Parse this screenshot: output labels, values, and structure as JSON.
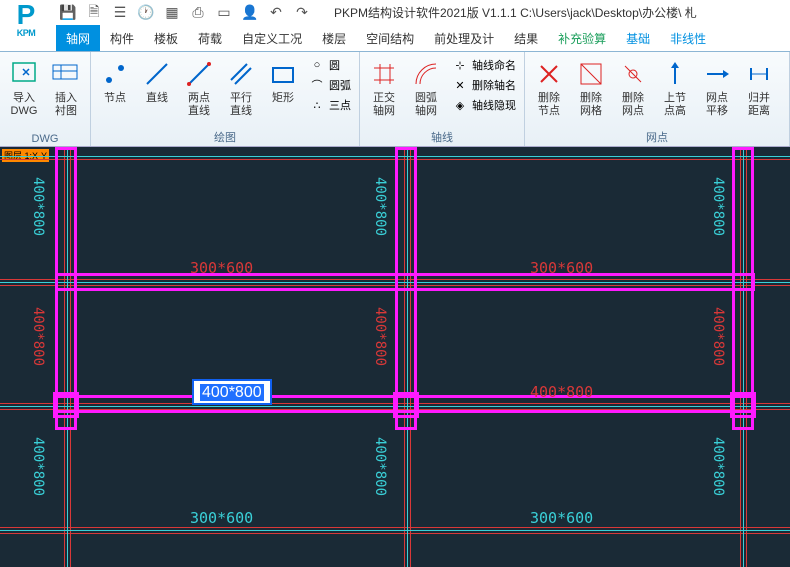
{
  "title": "PKPM结构设计软件2021版 V1.1.1 C:\\Users\\jack\\Desktop\\办公楼\\ 札",
  "menu": {
    "items": [
      "轴网",
      "构件",
      "楼板",
      "荷载",
      "自定义工况",
      "楼层",
      "空间结构",
      "前处理及计",
      "结果",
      "补充验算",
      "基础",
      "非线性"
    ],
    "active_index": 0,
    "green_indices": [
      9
    ],
    "blue_indices": [
      10,
      11
    ]
  },
  "ribbon": {
    "groups": [
      {
        "label": "DWG",
        "buttons": [
          {
            "name": "import-dwg",
            "label": "导入\nDWG"
          },
          {
            "name": "insert-liner",
            "label": "插入\n衬图"
          }
        ]
      },
      {
        "label": "绘图",
        "buttons": [
          {
            "name": "node",
            "label": "节点"
          },
          {
            "name": "line",
            "label": "直线"
          },
          {
            "name": "two-point-line",
            "label": "两点\n直线"
          },
          {
            "name": "parallel-line",
            "label": "平行\n直线"
          },
          {
            "name": "rect",
            "label": "矩形"
          }
        ],
        "small": [
          {
            "name": "circle",
            "label": "圆"
          },
          {
            "name": "arc",
            "label": "圆弧"
          },
          {
            "name": "three-point",
            "label": "三点"
          }
        ]
      },
      {
        "label": "轴线",
        "buttons": [
          {
            "name": "ortho-axis",
            "label": "正交\n轴网"
          },
          {
            "name": "arc-axis",
            "label": "圆弧\n轴网"
          }
        ],
        "small": [
          {
            "name": "axis-name",
            "label": "轴线命名"
          },
          {
            "name": "del-axis-name",
            "label": "删除轴名"
          },
          {
            "name": "axis-hide",
            "label": "轴线隐现"
          }
        ]
      },
      {
        "label": "网点",
        "buttons": [
          {
            "name": "del-node",
            "label": "删除\n节点"
          },
          {
            "name": "del-grid",
            "label": "删除\n网格"
          },
          {
            "name": "del-point",
            "label": "删除\n网点"
          },
          {
            "name": "node-height",
            "label": "上节\n点高"
          },
          {
            "name": "point-shift",
            "label": "网点\n平移"
          },
          {
            "name": "return-dist",
            "label": "归并\n距离"
          }
        ]
      }
    ]
  },
  "canvas": {
    "badge": "图层 1:X-Y",
    "dims": {
      "v400_800": "400*800",
      "h300_600": "300*600",
      "h400_800": "400*800",
      "edit_value": "400*800"
    }
  }
}
